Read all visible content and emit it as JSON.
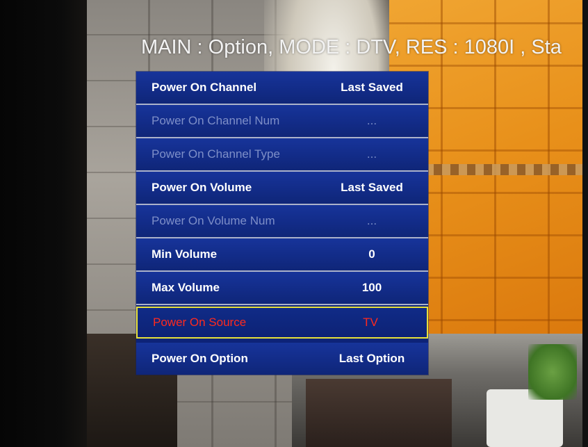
{
  "osd": {
    "header": "MAIN : Option, MODE : DTV, RES : 1080I , Sta"
  },
  "menu": {
    "items": [
      {
        "label": "Power On Channel",
        "value": "Last Saved",
        "state": "normal"
      },
      {
        "label": "Power On Channel Num",
        "value": "...",
        "state": "disabled"
      },
      {
        "label": "Power On Channel Type",
        "value": "...",
        "state": "disabled"
      },
      {
        "label": "Power On Volume",
        "value": "Last Saved",
        "state": "normal"
      },
      {
        "label": "Power On Volume Num",
        "value": "...",
        "state": "disabled"
      },
      {
        "label": "Min Volume",
        "value": "0",
        "state": "normal"
      },
      {
        "label": "Max Volume",
        "value": "100",
        "state": "normal"
      },
      {
        "label": "Power On Source",
        "value": "TV",
        "state": "selected"
      },
      {
        "label": "Power On Option",
        "value": "Last Option",
        "state": "normal"
      }
    ]
  },
  "colors": {
    "menu_background": "#0d2378",
    "selected_text": "#ff2a1e",
    "selected_border": "#e8e13a",
    "disabled_text": "#7e8fc8"
  }
}
